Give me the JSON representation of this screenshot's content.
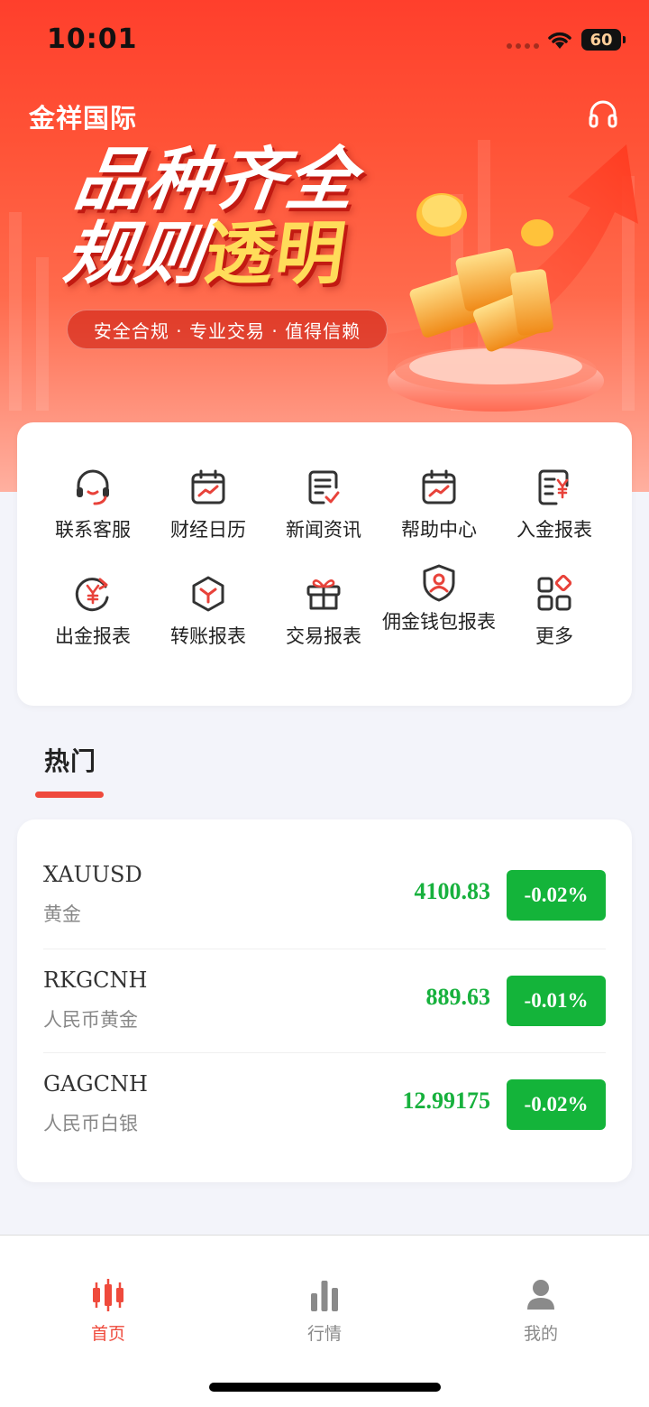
{
  "status_bar": {
    "time": "10:01",
    "battery": "60"
  },
  "header": {
    "brand": "金祥国际",
    "support_icon": "headset-icon"
  },
  "banner": {
    "line1": "品种齐全",
    "line2_a": "规则",
    "line2_b": "透明",
    "tagline": "安全合规 · 专业交易 · 值得信赖"
  },
  "menu": {
    "items": [
      {
        "label": "联系客服",
        "icon": "headset-icon"
      },
      {
        "label": "财经日历",
        "icon": "calendar-chart-icon"
      },
      {
        "label": "新闻资讯",
        "icon": "news-document-icon"
      },
      {
        "label": "帮助中心",
        "icon": "calendar-chart-icon"
      },
      {
        "label": "入金报表",
        "icon": "yuan-receipt-icon"
      },
      {
        "label": "出金报表",
        "icon": "yuan-refresh-icon"
      },
      {
        "label": "转账报表",
        "icon": "cube-icon"
      },
      {
        "label": "交易报表",
        "icon": "gift-icon"
      },
      {
        "label": "佣金钱包报表",
        "icon": "shield-user-icon"
      },
      {
        "label": "更多",
        "icon": "grid-more-icon"
      }
    ]
  },
  "hot": {
    "title": "热门",
    "quotes": [
      {
        "symbol": "XAUUSD",
        "name": "黄金",
        "price": "4100.83",
        "change": "-0.02%"
      },
      {
        "symbol": "RKGCNH",
        "name": "人民币黄金",
        "price": "889.63",
        "change": "-0.01%"
      },
      {
        "symbol": "GAGCNH",
        "name": "人民币白银",
        "price": "12.99175",
        "change": "-0.02%"
      }
    ]
  },
  "tabbar": {
    "tabs": [
      {
        "label": "首页",
        "icon": "candlestick-icon",
        "active": true
      },
      {
        "label": "行情",
        "icon": "bar-chart-icon",
        "active": false
      },
      {
        "label": "我的",
        "icon": "user-icon",
        "active": false
      }
    ]
  },
  "colors": {
    "accent": "#ef4a3c",
    "up_down_green": "#14b43a",
    "tab_inactive": "#8a8a8a"
  }
}
